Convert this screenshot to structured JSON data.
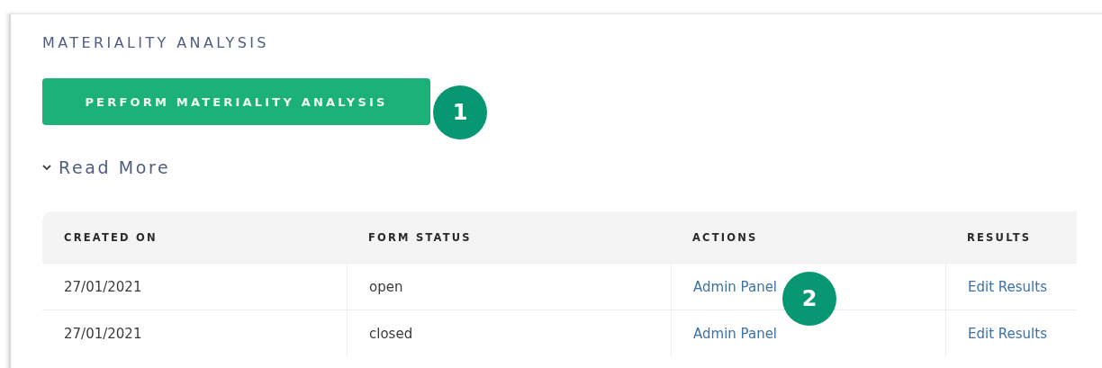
{
  "section": {
    "title": "MATERIALITY ANALYSIS"
  },
  "primary_button": {
    "label": "PERFORM MATERIALITY ANALYSIS"
  },
  "read_more": {
    "label": "Read More",
    "expanded": false
  },
  "table": {
    "columns": [
      "CREATED ON",
      "FORM STATUS",
      "ACTIONS",
      "RESULTS"
    ],
    "rows": [
      {
        "created_on": "27/01/2021",
        "form_status": "open",
        "action": "Admin Panel",
        "result": "Edit Results"
      },
      {
        "created_on": "27/01/2021",
        "form_status": "closed",
        "action": "Admin Panel",
        "result": "Edit Results"
      }
    ]
  },
  "callouts": [
    {
      "label": "1"
    },
    {
      "label": "2"
    }
  ]
}
